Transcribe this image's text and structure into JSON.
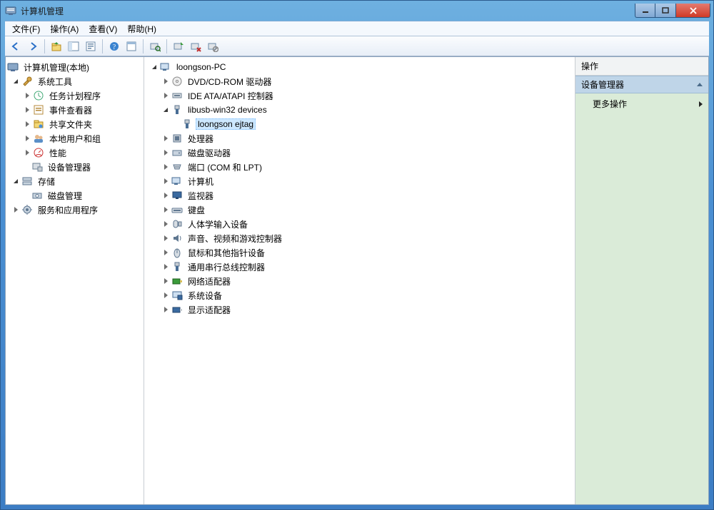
{
  "window": {
    "title": "计算机管理"
  },
  "menu": {
    "file": "文件(F)",
    "action": "操作(A)",
    "view": "查看(V)",
    "help": "帮助(H)"
  },
  "left_tree": {
    "root": "计算机管理(本地)",
    "system_tools": "系统工具",
    "task_sched": "任务计划程序",
    "event_viewer": "事件查看器",
    "shared_folders": "共享文件夹",
    "local_users": "本地用户和组",
    "performance": "性能",
    "device_mgr": "设备管理器",
    "storage": "存储",
    "disk_mgmt": "磁盘管理",
    "services_apps": "服务和应用程序"
  },
  "dev_tree": {
    "root": "loongson-PC",
    "dvd": "DVD/CD-ROM 驱动器",
    "ide": "IDE ATA/ATAPI 控制器",
    "libusb": "libusb-win32 devices",
    "ejtag": "loongson ejtag",
    "cpu": "处理器",
    "disk_drv": "磁盘驱动器",
    "ports": "端口 (COM 和 LPT)",
    "computer": "计算机",
    "monitor": "监视器",
    "keyboard": "键盘",
    "hid": "人体学输入设备",
    "audio": "声音、视频和游戏控制器",
    "mouse": "鼠标和其他指针设备",
    "usb": "通用串行总线控制器",
    "net": "网络适配器",
    "sysdev": "系统设备",
    "display": "显示适配器"
  },
  "right_panel": {
    "header": "操作",
    "section": "设备管理器",
    "more": "更多操作"
  }
}
